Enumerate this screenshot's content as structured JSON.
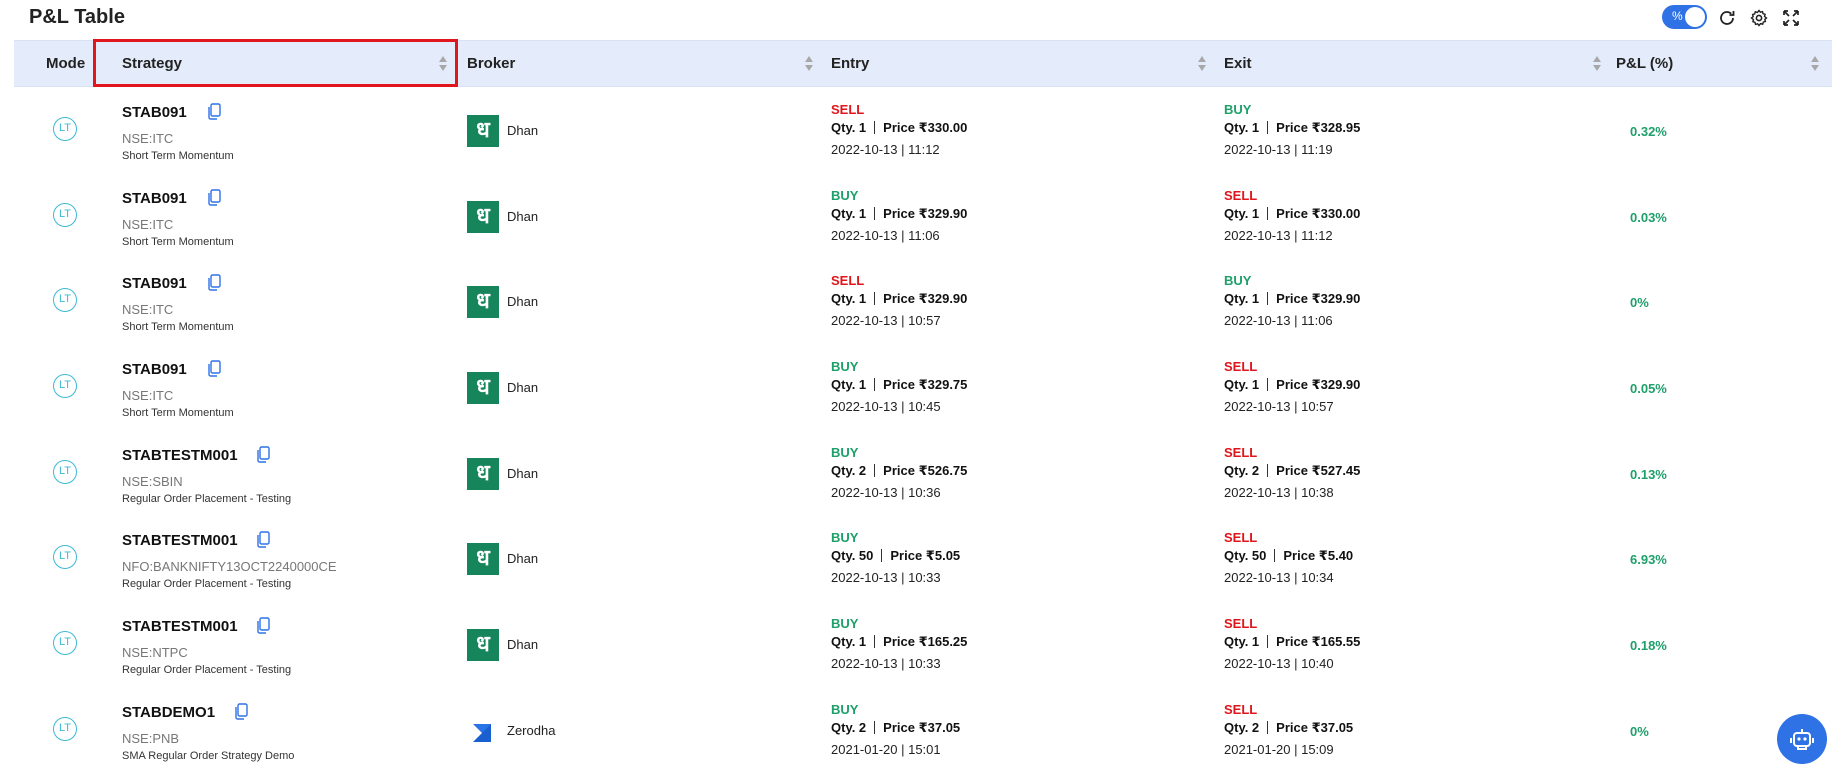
{
  "header": {
    "title": "P&L Table"
  },
  "toolbar": {
    "percent_toggle_label": "%",
    "percent_toggle_on": true
  },
  "table": {
    "columns": [
      "Mode",
      "Strategy",
      "Broker",
      "Entry",
      "Exit",
      "P&L (%)"
    ],
    "rows": [
      {
        "mode": "LT",
        "strategy": "STAB091",
        "symbol": "NSE:ITC",
        "description": "Short Term Momentum",
        "broker": "Dhan",
        "entry": {
          "side": "SELL",
          "qty": "Qty. 1",
          "price": "Price ₹330.00",
          "time": "2022-10-13 | 11:12"
        },
        "exit": {
          "side": "BUY",
          "qty": "Qty. 1",
          "price": "Price ₹328.95",
          "time": "2022-10-13 | 11:19"
        },
        "pnl": "0.32%"
      },
      {
        "mode": "LT",
        "strategy": "STAB091",
        "symbol": "NSE:ITC",
        "description": "Short Term Momentum",
        "broker": "Dhan",
        "entry": {
          "side": "BUY",
          "qty": "Qty. 1",
          "price": "Price ₹329.90",
          "time": "2022-10-13 | 11:06"
        },
        "exit": {
          "side": "SELL",
          "qty": "Qty. 1",
          "price": "Price ₹330.00",
          "time": "2022-10-13 | 11:12"
        },
        "pnl": "0.03%"
      },
      {
        "mode": "LT",
        "strategy": "STAB091",
        "symbol": "NSE:ITC",
        "description": "Short Term Momentum",
        "broker": "Dhan",
        "entry": {
          "side": "SELL",
          "qty": "Qty. 1",
          "price": "Price ₹329.90",
          "time": "2022-10-13 | 10:57"
        },
        "exit": {
          "side": "BUY",
          "qty": "Qty. 1",
          "price": "Price ₹329.90",
          "time": "2022-10-13 | 11:06"
        },
        "pnl": "0%"
      },
      {
        "mode": "LT",
        "strategy": "STAB091",
        "symbol": "NSE:ITC",
        "description": "Short Term Momentum",
        "broker": "Dhan",
        "entry": {
          "side": "BUY",
          "qty": "Qty. 1",
          "price": "Price ₹329.75",
          "time": "2022-10-13 | 10:45"
        },
        "exit": {
          "side": "SELL",
          "qty": "Qty. 1",
          "price": "Price ₹329.90",
          "time": "2022-10-13 | 10:57"
        },
        "pnl": "0.05%"
      },
      {
        "mode": "LT",
        "strategy": "STABTESTM001",
        "symbol": "NSE:SBIN",
        "description": "Regular Order Placement - Testing",
        "broker": "Dhan",
        "entry": {
          "side": "BUY",
          "qty": "Qty. 2",
          "price": "Price ₹526.75",
          "time": "2022-10-13 | 10:36"
        },
        "exit": {
          "side": "SELL",
          "qty": "Qty. 2",
          "price": "Price ₹527.45",
          "time": "2022-10-13 | 10:38"
        },
        "pnl": "0.13%"
      },
      {
        "mode": "LT",
        "strategy": "STABTESTM001",
        "symbol": "NFO:BANKNIFTY13OCT2240000CE",
        "description": "Regular Order Placement - Testing",
        "broker": "Dhan",
        "entry": {
          "side": "BUY",
          "qty": "Qty. 50",
          "price": "Price ₹5.05",
          "time": "2022-10-13 | 10:33"
        },
        "exit": {
          "side": "SELL",
          "qty": "Qty. 50",
          "price": "Price ₹5.40",
          "time": "2022-10-13 | 10:34"
        },
        "pnl": "6.93%"
      },
      {
        "mode": "LT",
        "strategy": "STABTESTM001",
        "symbol": "NSE:NTPC",
        "description": "Regular Order Placement - Testing",
        "broker": "Dhan",
        "entry": {
          "side": "BUY",
          "qty": "Qty. 1",
          "price": "Price ₹165.25",
          "time": "2022-10-13 | 10:33"
        },
        "exit": {
          "side": "SELL",
          "qty": "Qty. 1",
          "price": "Price ₹165.55",
          "time": "2022-10-13 | 10:40"
        },
        "pnl": "0.18%"
      },
      {
        "mode": "LT",
        "strategy": "STABDEMO1",
        "symbol": "NSE:PNB",
        "description": "SMA Regular Order Strategy Demo",
        "broker": "Zerodha",
        "entry": {
          "side": "BUY",
          "qty": "Qty. 2",
          "price": "Price ₹37.05",
          "time": "2021-01-20 | 15:01"
        },
        "exit": {
          "side": "SELL",
          "qty": "Qty. 2",
          "price": "Price ₹37.05",
          "time": "2021-01-20 | 15:09"
        },
        "pnl": "0%"
      }
    ]
  },
  "colors": {
    "buy": "#1ea06a",
    "sell": "#e0161c",
    "accent": "#2f72e6",
    "header_bg": "#e4ecfb",
    "highlight": "#e0161c",
    "dhan": "#17855c",
    "zerodha": "#2a73e6"
  },
  "icons": {
    "refresh": "refresh-icon",
    "settings": "gear-icon",
    "fullscreen": "expand-icon",
    "copy": "copy-icon",
    "chatbot": "robot-icon"
  }
}
